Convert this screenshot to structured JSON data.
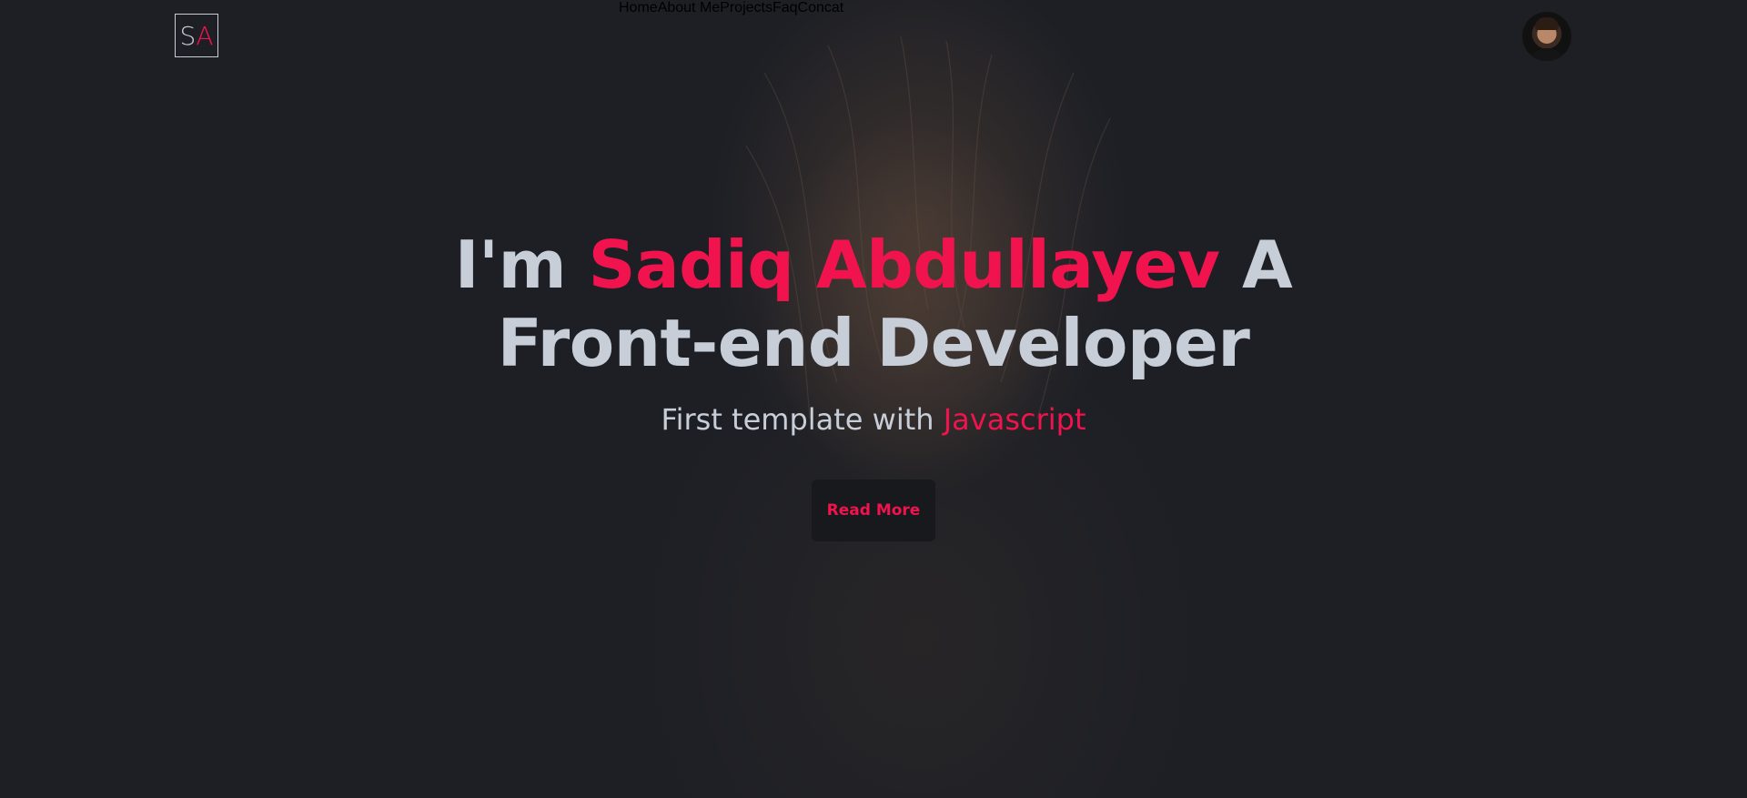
{
  "logo": {
    "first": "S",
    "second": "A"
  },
  "nav": {
    "items": [
      {
        "label": "Home"
      },
      {
        "label": "About Me"
      },
      {
        "label": "Projects"
      },
      {
        "label": "Faq"
      },
      {
        "label": "Concat"
      }
    ]
  },
  "hero": {
    "headline_prefix": "I'm ",
    "headline_name": "Sadiq Abdullayev",
    "headline_suffix": " A",
    "headline_line2": "Front-end Developer",
    "subtitle_prefix": "First template with ",
    "subtitle_accent": "Javascript",
    "button_label": "Read More"
  },
  "colors": {
    "background": "#1d1f25",
    "text": "#c7ced8",
    "accent": "#f0134d",
    "button_bg": "#18191d"
  },
  "icons": {
    "avatar": "user-avatar"
  }
}
